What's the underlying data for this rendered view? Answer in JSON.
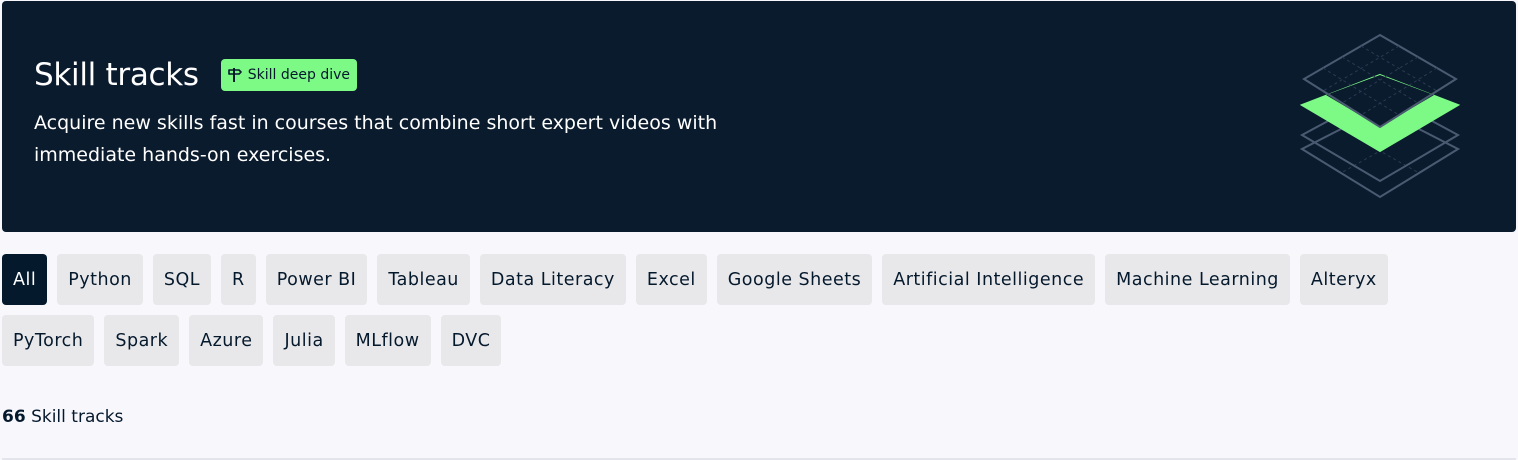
{
  "hero": {
    "title": "Skill tracks",
    "badge": "Skill deep dive",
    "description": "Acquire new skills fast in courses that combine short expert videos with immediate hands-on exercises."
  },
  "filters": {
    "row1": [
      "All",
      "Python",
      "SQL",
      "R",
      "Power BI",
      "Tableau",
      "Data Literacy",
      "Excel",
      "Google Sheets",
      "Artificial Intelligence",
      "Machine Learning",
      "Alteryx"
    ],
    "row2": [
      "PyTorch",
      "Spark",
      "Azure",
      "Julia",
      "MLflow",
      "DVC"
    ],
    "active": "All"
  },
  "results": {
    "count": "66",
    "label": "Skill tracks"
  },
  "colors": {
    "hero_bg": "#0b1b2e",
    "accent_green": "#7dfa86",
    "chip_bg": "#e8e8ea",
    "chip_active_bg": "#05192d"
  },
  "icons": {
    "badge": "signpost-icon",
    "hero_art": "stacked-layers-icon"
  }
}
